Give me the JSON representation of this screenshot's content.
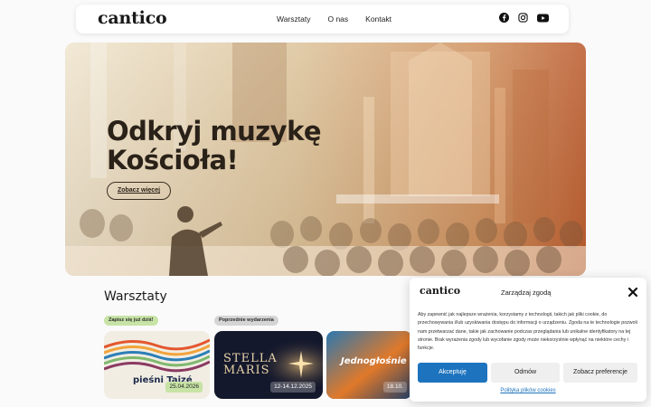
{
  "header": {
    "logo": "cantico",
    "nav": [
      "Warsztaty",
      "O nas",
      "Kontakt"
    ],
    "social": [
      "facebook-icon",
      "instagram-icon",
      "youtube-icon"
    ]
  },
  "hero": {
    "title_line1": "Odkryj muzykę",
    "title_line2": "Kościoła!",
    "button": "Zobacz więcej"
  },
  "workshops": {
    "title": "Warsztaty",
    "badge_signup": "Zapisz się już dziś!",
    "badge_previous": "Poprzednie wydarzenia",
    "cards": [
      {
        "title": "pieśni Taizé",
        "date": "25.04.2026"
      },
      {
        "title": "STELLA MARIS",
        "date": "12-14.12.2025"
      },
      {
        "title": "Jednogłośnie",
        "date": "18.10."
      }
    ]
  },
  "cookie": {
    "logo": "cantico",
    "heading": "Zarządzaj zgodą",
    "text": "Aby zapewnić jak najlepsze wrażenia, korzystamy z technologii, takich jak pliki cookie, do przechowywania i/lub uzyskiwania dostępu do informacji o urządzeniu. Zgoda na te technologie pozwoli nam przetwarzać dane, takie jak zachowanie podczas przeglądania lub unikalne identyfikatory na tej stronie. Brak wyrażenia zgody lub wycofanie zgody może niekorzystnie wpłynąć na niektóre cechy i funkcje.",
    "accept": "Akceptuję",
    "deny": "Odmów",
    "preferences": "Zobacz preferencje",
    "policy": "Polityka plików cookies"
  },
  "colors": {
    "accept_blue": "#1d73be",
    "badge_green": "#c7e3a6",
    "hero_warm": "#c06a3a"
  }
}
